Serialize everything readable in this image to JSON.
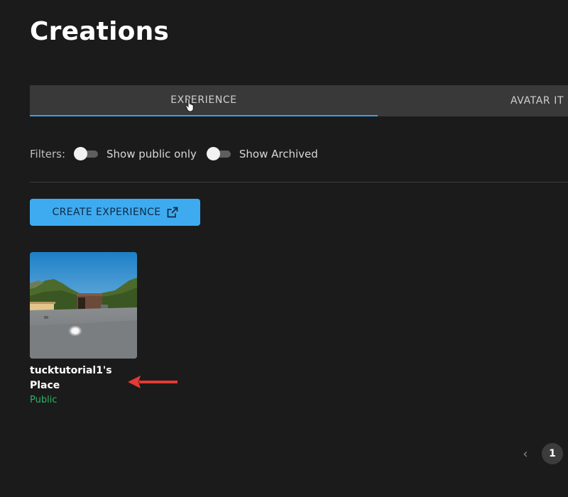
{
  "page": {
    "title": "Creations"
  },
  "tabs": [
    {
      "label": "EXPERIENCE",
      "active": true
    },
    {
      "label": "AVATAR IT"
    }
  ],
  "filters": {
    "label": "Filters:",
    "toggles": [
      {
        "label": "Show public only",
        "on": false
      },
      {
        "label": "Show Archived",
        "on": false
      }
    ]
  },
  "actions": {
    "create_label": "CREATE EXPERIENCE",
    "create_icon": "external-link-icon"
  },
  "experiences": [
    {
      "name": "tucktutorial1's Place",
      "status": "Public",
      "status_color": "#2fb366"
    }
  ],
  "pagination": {
    "current_page": "1",
    "prev_icon": "chevron-left-icon"
  },
  "colors": {
    "accent": "#3eabf0",
    "tab_underline": "#3aa0e8",
    "annotation_arrow": "#e53935"
  }
}
